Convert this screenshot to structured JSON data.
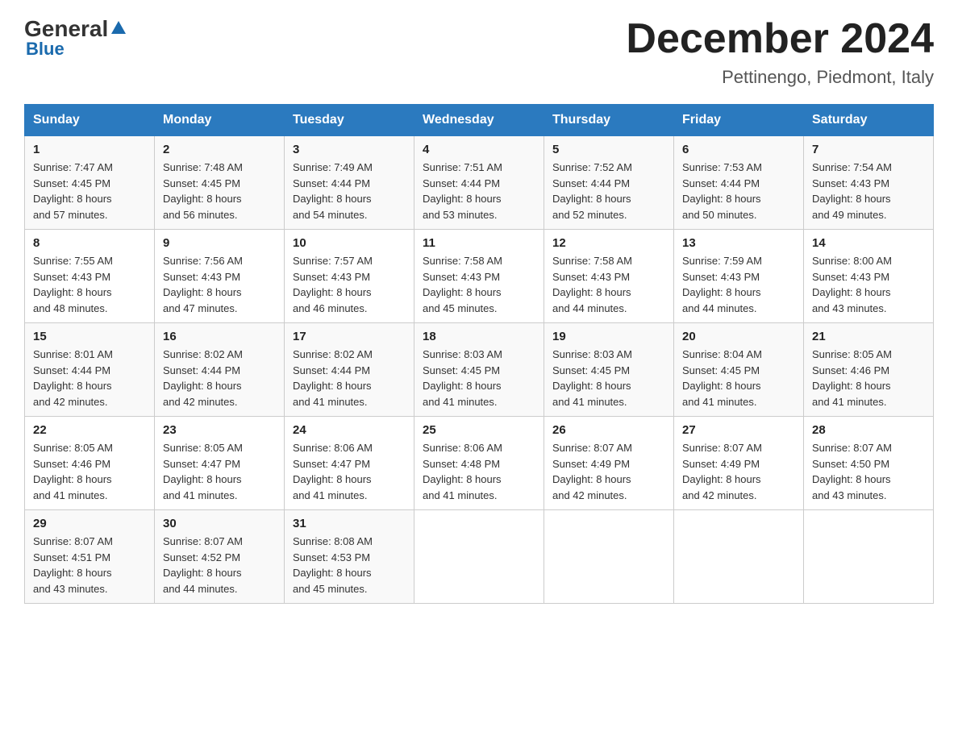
{
  "header": {
    "logo_general": "General",
    "logo_blue": "Blue",
    "month_title": "December 2024",
    "location": "Pettinengo, Piedmont, Italy"
  },
  "days_of_week": [
    "Sunday",
    "Monday",
    "Tuesday",
    "Wednesday",
    "Thursday",
    "Friday",
    "Saturday"
  ],
  "weeks": [
    [
      {
        "day": "1",
        "info": "Sunrise: 7:47 AM\nSunset: 4:45 PM\nDaylight: 8 hours\nand 57 minutes."
      },
      {
        "day": "2",
        "info": "Sunrise: 7:48 AM\nSunset: 4:45 PM\nDaylight: 8 hours\nand 56 minutes."
      },
      {
        "day": "3",
        "info": "Sunrise: 7:49 AM\nSunset: 4:44 PM\nDaylight: 8 hours\nand 54 minutes."
      },
      {
        "day": "4",
        "info": "Sunrise: 7:51 AM\nSunset: 4:44 PM\nDaylight: 8 hours\nand 53 minutes."
      },
      {
        "day": "5",
        "info": "Sunrise: 7:52 AM\nSunset: 4:44 PM\nDaylight: 8 hours\nand 52 minutes."
      },
      {
        "day": "6",
        "info": "Sunrise: 7:53 AM\nSunset: 4:44 PM\nDaylight: 8 hours\nand 50 minutes."
      },
      {
        "day": "7",
        "info": "Sunrise: 7:54 AM\nSunset: 4:43 PM\nDaylight: 8 hours\nand 49 minutes."
      }
    ],
    [
      {
        "day": "8",
        "info": "Sunrise: 7:55 AM\nSunset: 4:43 PM\nDaylight: 8 hours\nand 48 minutes."
      },
      {
        "day": "9",
        "info": "Sunrise: 7:56 AM\nSunset: 4:43 PM\nDaylight: 8 hours\nand 47 minutes."
      },
      {
        "day": "10",
        "info": "Sunrise: 7:57 AM\nSunset: 4:43 PM\nDaylight: 8 hours\nand 46 minutes."
      },
      {
        "day": "11",
        "info": "Sunrise: 7:58 AM\nSunset: 4:43 PM\nDaylight: 8 hours\nand 45 minutes."
      },
      {
        "day": "12",
        "info": "Sunrise: 7:58 AM\nSunset: 4:43 PM\nDaylight: 8 hours\nand 44 minutes."
      },
      {
        "day": "13",
        "info": "Sunrise: 7:59 AM\nSunset: 4:43 PM\nDaylight: 8 hours\nand 44 minutes."
      },
      {
        "day": "14",
        "info": "Sunrise: 8:00 AM\nSunset: 4:43 PM\nDaylight: 8 hours\nand 43 minutes."
      }
    ],
    [
      {
        "day": "15",
        "info": "Sunrise: 8:01 AM\nSunset: 4:44 PM\nDaylight: 8 hours\nand 42 minutes."
      },
      {
        "day": "16",
        "info": "Sunrise: 8:02 AM\nSunset: 4:44 PM\nDaylight: 8 hours\nand 42 minutes."
      },
      {
        "day": "17",
        "info": "Sunrise: 8:02 AM\nSunset: 4:44 PM\nDaylight: 8 hours\nand 41 minutes."
      },
      {
        "day": "18",
        "info": "Sunrise: 8:03 AM\nSunset: 4:45 PM\nDaylight: 8 hours\nand 41 minutes."
      },
      {
        "day": "19",
        "info": "Sunrise: 8:03 AM\nSunset: 4:45 PM\nDaylight: 8 hours\nand 41 minutes."
      },
      {
        "day": "20",
        "info": "Sunrise: 8:04 AM\nSunset: 4:45 PM\nDaylight: 8 hours\nand 41 minutes."
      },
      {
        "day": "21",
        "info": "Sunrise: 8:05 AM\nSunset: 4:46 PM\nDaylight: 8 hours\nand 41 minutes."
      }
    ],
    [
      {
        "day": "22",
        "info": "Sunrise: 8:05 AM\nSunset: 4:46 PM\nDaylight: 8 hours\nand 41 minutes."
      },
      {
        "day": "23",
        "info": "Sunrise: 8:05 AM\nSunset: 4:47 PM\nDaylight: 8 hours\nand 41 minutes."
      },
      {
        "day": "24",
        "info": "Sunrise: 8:06 AM\nSunset: 4:47 PM\nDaylight: 8 hours\nand 41 minutes."
      },
      {
        "day": "25",
        "info": "Sunrise: 8:06 AM\nSunset: 4:48 PM\nDaylight: 8 hours\nand 41 minutes."
      },
      {
        "day": "26",
        "info": "Sunrise: 8:07 AM\nSunset: 4:49 PM\nDaylight: 8 hours\nand 42 minutes."
      },
      {
        "day": "27",
        "info": "Sunrise: 8:07 AM\nSunset: 4:49 PM\nDaylight: 8 hours\nand 42 minutes."
      },
      {
        "day": "28",
        "info": "Sunrise: 8:07 AM\nSunset: 4:50 PM\nDaylight: 8 hours\nand 43 minutes."
      }
    ],
    [
      {
        "day": "29",
        "info": "Sunrise: 8:07 AM\nSunset: 4:51 PM\nDaylight: 8 hours\nand 43 minutes."
      },
      {
        "day": "30",
        "info": "Sunrise: 8:07 AM\nSunset: 4:52 PM\nDaylight: 8 hours\nand 44 minutes."
      },
      {
        "day": "31",
        "info": "Sunrise: 8:08 AM\nSunset: 4:53 PM\nDaylight: 8 hours\nand 45 minutes."
      },
      {
        "day": "",
        "info": ""
      },
      {
        "day": "",
        "info": ""
      },
      {
        "day": "",
        "info": ""
      },
      {
        "day": "",
        "info": ""
      }
    ]
  ]
}
